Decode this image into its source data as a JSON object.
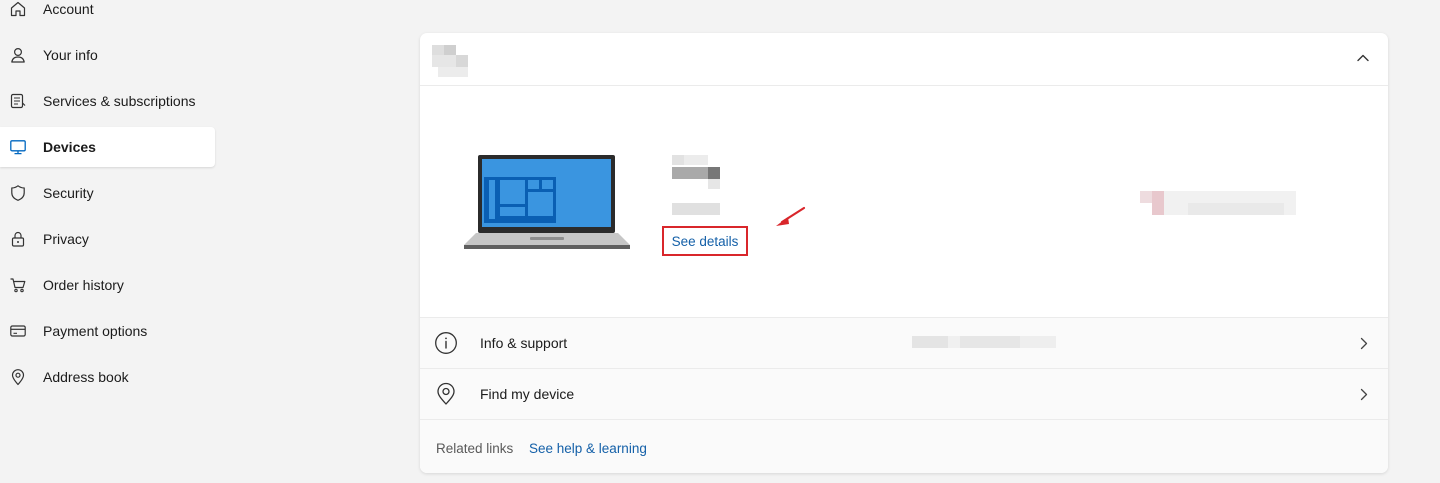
{
  "sidebar": {
    "items": [
      {
        "label": "Account",
        "icon": "home-icon"
      },
      {
        "label": "Your info",
        "icon": "person-icon"
      },
      {
        "label": "Services & subscriptions",
        "icon": "subscriptions-icon"
      },
      {
        "label": "Devices",
        "icon": "monitor-icon",
        "active": true
      },
      {
        "label": "Security",
        "icon": "shield-icon"
      },
      {
        "label": "Privacy",
        "icon": "lock-icon"
      },
      {
        "label": "Order history",
        "icon": "cart-icon"
      },
      {
        "label": "Payment options",
        "icon": "credit-card-icon"
      },
      {
        "label": "Address book",
        "icon": "location-pin-icon"
      }
    ]
  },
  "device_card": {
    "header_icon": "chevron-up-icon",
    "device_image": "laptop-icon",
    "see_details_label": "See details",
    "rows": [
      {
        "label": "Info & support",
        "icon": "info-icon"
      },
      {
        "label": "Find my device",
        "icon": "location-pin-icon"
      }
    ],
    "footer": {
      "related_label": "Related links",
      "link_label": "See help & learning"
    }
  },
  "colors": {
    "page_bg": "#f3f3f3",
    "link": "#1460a8",
    "highlight_box": "#d9262b",
    "accent_blue": "#0078d4"
  }
}
